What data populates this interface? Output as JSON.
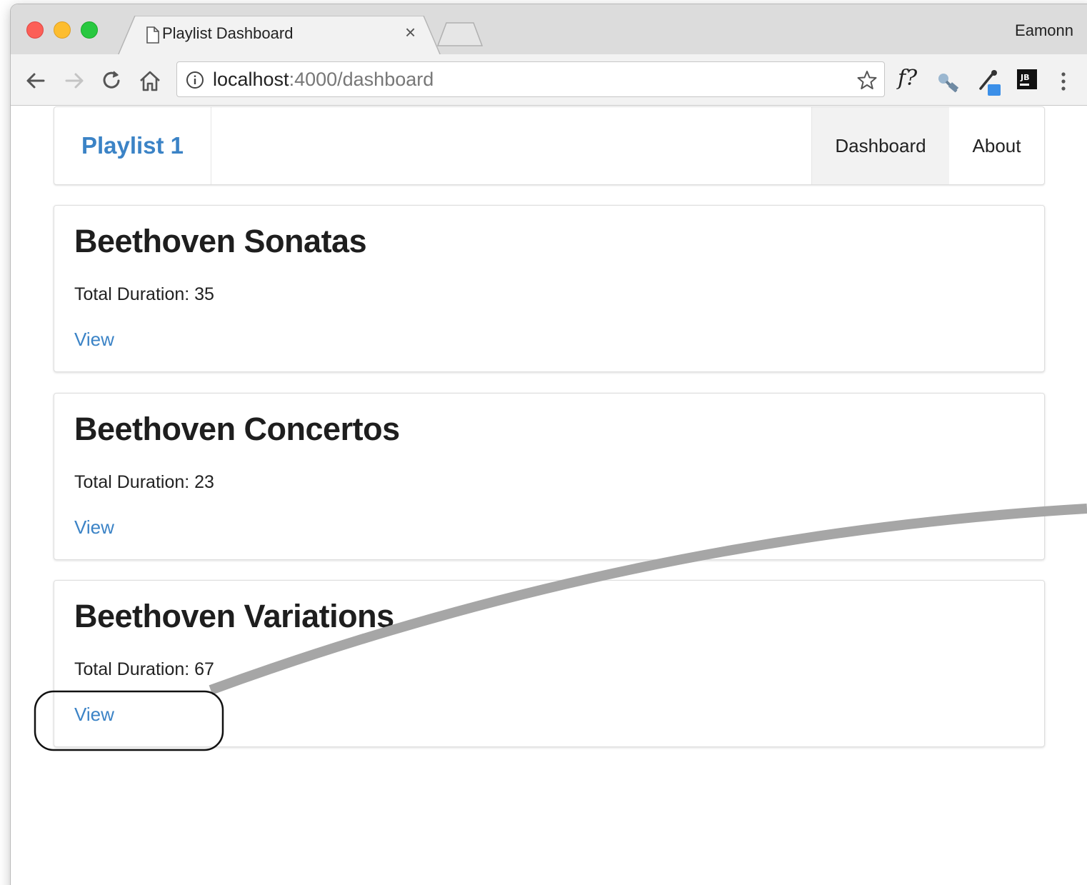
{
  "browser": {
    "tab_title": "Playlist Dashboard",
    "tab_close": "×",
    "profile_name": "Eamonn",
    "url_host": "localhost",
    "url_rest": ":4000/dashboard",
    "ext_function_label": "f?"
  },
  "navbar": {
    "brand": "Playlist 1",
    "items": [
      {
        "label": "Dashboard",
        "active": true
      },
      {
        "label": "About",
        "active": false
      }
    ]
  },
  "playlists": [
    {
      "title": "Beethoven Sonatas",
      "duration": "Total Duration: 35",
      "link": "View"
    },
    {
      "title": "Beethoven Concertos",
      "duration": "Total Duration: 23",
      "link": "View"
    },
    {
      "title": "Beethoven Variations",
      "duration": "Total Duration: 67",
      "link": "View"
    }
  ],
  "colors": {
    "accent": "#3b83c6",
    "annotation_line": "#a6a6a6"
  }
}
